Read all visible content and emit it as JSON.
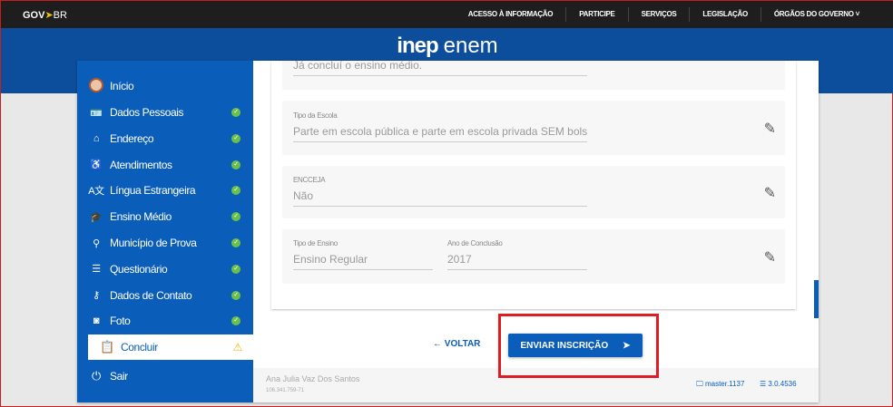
{
  "topbar": {
    "brand_a": "GOV",
    "brand_b": "BR",
    "nav": [
      "ACESSO À INFORMAÇÃO",
      "PARTICIPE",
      "SERVIÇOS",
      "LEGISLAÇÃO",
      "ÓRGÃOS DO GOVERNO"
    ]
  },
  "header": {
    "logo_a": "inep",
    "logo_b": "enem"
  },
  "sidebar": {
    "home": "Início",
    "items": [
      {
        "label": "Dados Pessoais",
        "icon": "id-card-icon",
        "glyph": "🪪"
      },
      {
        "label": "Endereço",
        "icon": "home-icon",
        "glyph": "⌂"
      },
      {
        "label": "Atendimentos",
        "icon": "wheelchair-icon",
        "glyph": "♿"
      },
      {
        "label": "Língua Estrangeira",
        "icon": "language-icon",
        "glyph": "A文"
      },
      {
        "label": "Ensino Médio",
        "icon": "graduate-icon",
        "glyph": "🎓"
      },
      {
        "label": "Município de Prova",
        "icon": "map-icon",
        "glyph": "⚲"
      },
      {
        "label": "Questionário",
        "icon": "clipboard-list-icon",
        "glyph": "☰"
      },
      {
        "label": "Dados de Contato",
        "icon": "key-icon",
        "glyph": "⚷"
      },
      {
        "label": "Foto",
        "icon": "camera-icon",
        "glyph": "◙"
      }
    ],
    "active": "Concluir",
    "logout": "Sair"
  },
  "form": {
    "f1_value": "Já concluí o ensino médio.",
    "f2_label": "Tipo da Escola",
    "f2_value": "Parte em escola pública e parte em escola privada SEM bolsa d",
    "f3_label": "ENCCEJA",
    "f3_value": "Não",
    "f4_label": "Tipo de Ensino",
    "f4_value": "Ensino Regular",
    "f5_label": "Ano de Conclusão",
    "f5_value": "2017"
  },
  "actions": {
    "back": "← VOLTAR",
    "send": "ENVIAR INSCRIÇÃO",
    "send_arrow": "➤"
  },
  "footer": {
    "name": "Ana Julia Vaz Dos Santos",
    "cpf": "106.341.759-71",
    "build": "master.1137",
    "version": "3.0.4536"
  }
}
